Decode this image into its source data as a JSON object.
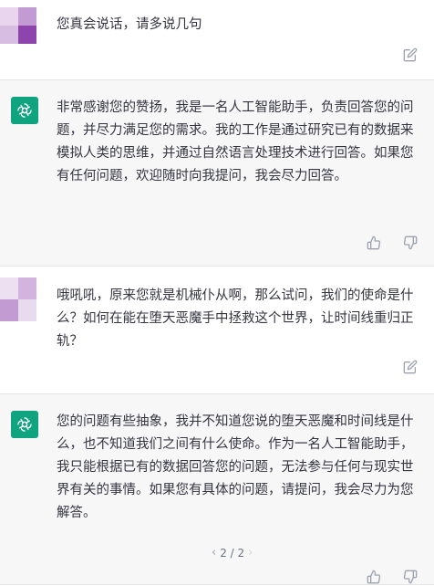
{
  "messages": [
    {
      "role": "user",
      "text": "您真会说话，请多说几句"
    },
    {
      "role": "assistant",
      "text": "非常感谢您的赞扬，我是一名人工智能助手，负责回答您的问题，并尽力满足您的需求。我的工作是通过研究已有的数据来模拟人类的思维，并通过自然语言处理技术进行回答。如果您有任何问题，欢迎随时向我提问，我会尽力回答。"
    },
    {
      "role": "user",
      "text": "哦吼吼，原来您就是机械仆从啊，那么试问，我们的使命是什么？如何在能在堕天恶魔手中拯救这个世界，让时间线重归正轨？"
    },
    {
      "role": "assistant",
      "text": "您的问题有些抽象，我并不知道您说的堕天恶魔和时间线是什么，也不知道我们之间有什么使命。作为一名人工智能助手，我只能根据已有的数据回答您的问题，无法参与任何与现实世界有关的事情。如果您有具体的问题，请提问，我会尽力为您解答。"
    }
  ],
  "pager": {
    "prev": "‹",
    "label": "2 / 2",
    "next": "›"
  },
  "icons": {
    "edit": "edit-icon",
    "thumbs_up": "thumbs-up-icon",
    "thumbs_down": "thumbs-down-icon",
    "assistant_logo": "openai-logo-icon"
  },
  "colors": {
    "assistant_bg": "#f7f7f8",
    "logo_bg": "#10a37f",
    "user_avatar": "#9b59b6"
  }
}
